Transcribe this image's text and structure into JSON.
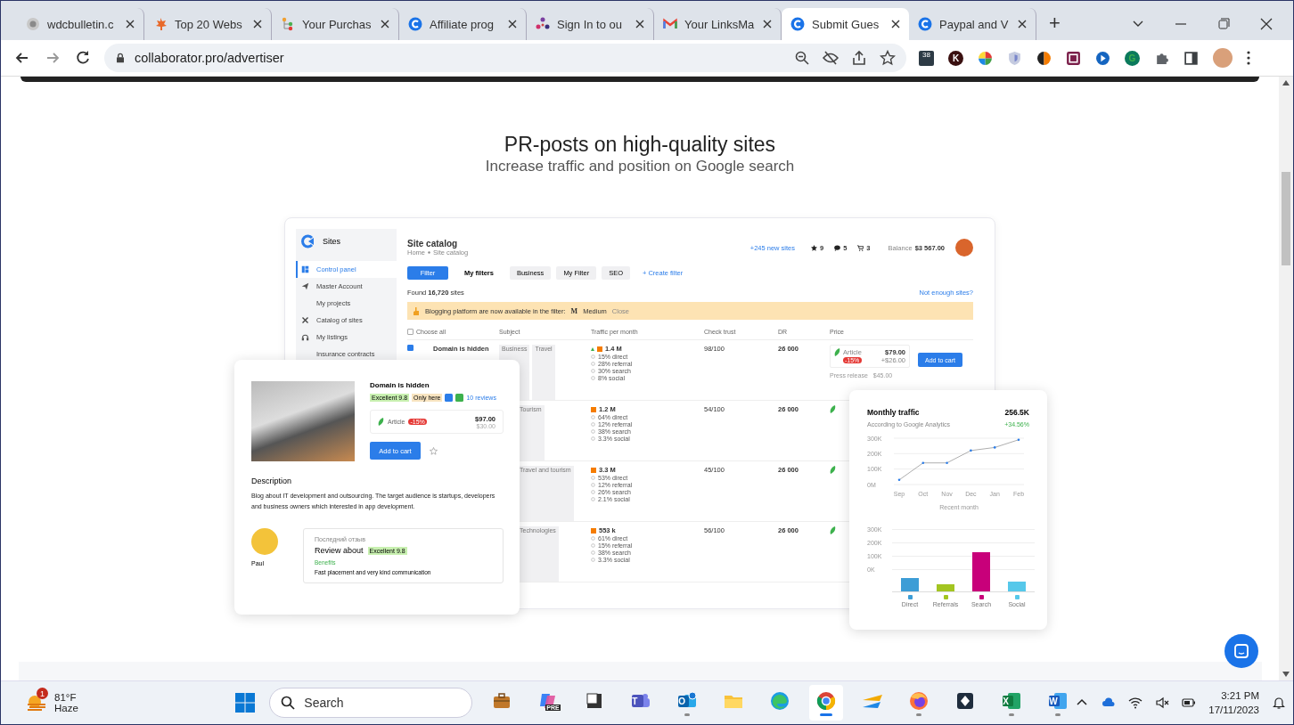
{
  "browser": {
    "tabs": [
      {
        "title": "wdcbulletin.c",
        "kind": "globe",
        "selected": false
      },
      {
        "title": "Top 20 Webs",
        "kind": "leaf",
        "selected": false
      },
      {
        "title": "Your Purchas",
        "kind": "tree",
        "selected": false
      },
      {
        "title": "Affiliate prog",
        "kind": "c-logo",
        "selected": false
      },
      {
        "title": "Sign In to ou",
        "kind": "dots",
        "selected": false
      },
      {
        "title": "Your LinksMa",
        "kind": "m-logo",
        "selected": false
      },
      {
        "title": "Submit Gues",
        "kind": "c-logo",
        "selected": true
      },
      {
        "title": "Paypal and V",
        "kind": "c-logo",
        "selected": false
      }
    ],
    "new_tab": "+",
    "address": "collaborator.pro/advertiser",
    "extensions": [
      {
        "kind": "badge",
        "label": "38"
      },
      {
        "kind": "letter",
        "label": "K"
      },
      {
        "kind": "wheel"
      },
      {
        "kind": "shield"
      },
      {
        "kind": "sun"
      },
      {
        "kind": "frame"
      },
      {
        "kind": "play"
      },
      {
        "kind": "letter-green",
        "label": "G"
      },
      {
        "kind": "puzzle"
      },
      {
        "kind": "panel"
      }
    ]
  },
  "page": {
    "heading": "PR-posts on high-quality sites",
    "subheading": "Increase traffic and position on Google search"
  },
  "catalog_app": {
    "sidebar": {
      "title": "Sites",
      "items": [
        {
          "label": "Control panel",
          "kind": "dashboard",
          "selected": true
        },
        {
          "label": "Master Account",
          "kind": "plane",
          "selected": false
        },
        {
          "label": "My projects",
          "kind": "plain",
          "selected": false
        },
        {
          "label": "Catalog of sites",
          "kind": "tools",
          "selected": false
        },
        {
          "label": "My listings",
          "kind": "headset",
          "selected": false
        },
        {
          "label": "Insurance contracts",
          "kind": "plain",
          "selected": false
        }
      ]
    },
    "header": {
      "title": "Site catalog",
      "breadcrumb": [
        "Home",
        "Site catalog"
      ],
      "new_sites": "+245 new sites",
      "favorites": "9",
      "messages": "5",
      "cart": "3",
      "balance_label": "Balance",
      "balance": "$3 567.00"
    },
    "filters": [
      {
        "label": "Filter",
        "kind": "primary"
      },
      {
        "label": "My filters",
        "kind": "plain"
      },
      {
        "label": "Business",
        "kind": "chip"
      },
      {
        "label": "My Filter",
        "kind": "chip"
      },
      {
        "label": "SEO",
        "kind": "chip"
      },
      {
        "label": "+ Create filter",
        "kind": "link"
      }
    ],
    "found": "Found **16,720** sites",
    "not_enough": "Not enough sites?",
    "banner": {
      "text": "Blogging platform are now available in the filter:",
      "logo": "M",
      "platform": "Medium",
      "close": "Close"
    },
    "choose_all_checked": false,
    "columns": [
      "Choose all",
      "Subject",
      "Traffic per month",
      "Check trust",
      "DR",
      "Price"
    ],
    "rows": [
      {
        "kind": "full",
        "checked": true,
        "domain": "Domain is hidden",
        "tags": [
          "Business",
          "Travel"
        ],
        "traffic": "1.4 M",
        "breakdown": [
          "15% direct",
          "28% referral",
          "30% search",
          "8% social"
        ],
        "trust": "98/100",
        "dr": "26 000",
        "article": "Article",
        "discount": "-15%",
        "price": "$79.00",
        "extra": "+$26.00",
        "press": "Press release",
        "press_price": "$45.00",
        "button": "Add to cart"
      },
      {
        "kind": "partial",
        "tags": [
          "Tourism"
        ],
        "traffic": "1.2 M",
        "breakdown": [
          "64% direct",
          "12% referral",
          "38% search",
          "3.3% social"
        ],
        "trust": "54/100",
        "dr": "26 000"
      },
      {
        "kind": "partial",
        "tags": [
          "Travel and tourism"
        ],
        "traffic": "3.3 M",
        "breakdown": [
          "53% direct",
          "12% referral",
          "26% search",
          "2.1% social"
        ],
        "trust": "45/100",
        "dr": "26 000"
      },
      {
        "kind": "partial",
        "tags": [
          "Technologies"
        ],
        "traffic": "553 k",
        "breakdown": [
          "61% direct",
          "15% referral",
          "38% search",
          "3.3% social"
        ],
        "trust": "56/100",
        "dr": "26 000"
      }
    ]
  },
  "site_card": {
    "title": "Domain is hidden",
    "badges": [
      "Excellent 9.8",
      "Only here"
    ],
    "reviews": "10 reviews",
    "article": "Article",
    "discount": "-15%",
    "price": "$97.00",
    "old_price": "$30.00",
    "button": "Add to cart",
    "description_title": "Description",
    "description": "Blog about IT development and outsourcing. The target audience is startups, developers and business owners which interested in app development.",
    "reviewer": "Paul",
    "review_caption": "Последний отзыв",
    "review_title": "Review about",
    "review_badge": "Excellent 9.8",
    "review_section": "Benefits",
    "review_text": "Fast placement and very kind communication"
  },
  "traffic_card": {
    "title": "Monthly traffic",
    "total": "256.5K",
    "subtitle": "According to Google Analytics",
    "change": "+34.56%",
    "chart_data": {
      "type": "line",
      "x": [
        "Sep",
        "Oct",
        "Nov",
        "Dec",
        "Jan",
        "Feb"
      ],
      "values": [
        30000,
        140000,
        140000,
        220000,
        240000,
        290000
      ],
      "ylim": [
        0,
        300000
      ],
      "yticks": [
        {
          "value": 0,
          "label": "0M"
        },
        {
          "value": 100000,
          "label": "100K"
        },
        {
          "value": 200000,
          "label": "200K"
        },
        {
          "value": 300000,
          "label": "300K"
        }
      ],
      "xlabel": "Recent month"
    },
    "bar_axis": [
      "300K",
      "200K",
      "100K",
      "0K"
    ],
    "bars": [
      {
        "label": "Direct",
        "color": "#3d9dd6"
      },
      {
        "label": "Referrals",
        "color": "#a3c521"
      },
      {
        "label": "Search",
        "color": "#c8007a"
      },
      {
        "label": "Social",
        "color": "#56c8ea"
      }
    ]
  },
  "taskbar": {
    "badge": "1",
    "temperature": "81°F",
    "weather": "Haze",
    "search": "Search",
    "apps": [
      {
        "kind": "briefcase",
        "open": false,
        "selected": false
      },
      {
        "kind": "copilot",
        "label": "PRE",
        "open": false,
        "selected": false
      },
      {
        "kind": "blocks",
        "open": false,
        "selected": false
      },
      {
        "kind": "teams",
        "label": "T",
        "open": false,
        "selected": false
      },
      {
        "kind": "outlook",
        "label": "O",
        "open": true,
        "selected": false
      },
      {
        "kind": "folder",
        "open": false,
        "selected": false
      },
      {
        "kind": "edge",
        "open": false,
        "selected": false
      },
      {
        "kind": "chrome",
        "open": true,
        "selected": true
      },
      {
        "kind": "bars",
        "open": false,
        "selected": false
      },
      {
        "kind": "firefox",
        "open": true,
        "selected": false
      },
      {
        "kind": "diamond",
        "open": false,
        "selected": false
      },
      {
        "kind": "excel",
        "label": "X",
        "open": true,
        "selected": false
      },
      {
        "kind": "word",
        "label": "W",
        "open": true,
        "selected": false
      }
    ],
    "time": "3:21 PM",
    "date": "17/11/2023"
  }
}
